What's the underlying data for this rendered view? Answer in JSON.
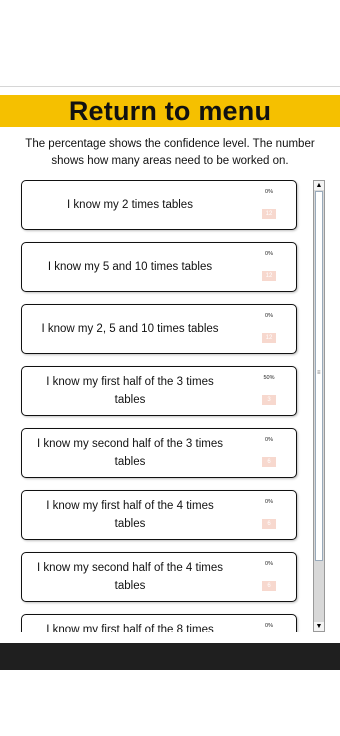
{
  "header": {
    "return_label": "Return to menu"
  },
  "instructions": {
    "line1": "The percentage shows the confidence level. The number",
    "line2": "shows how many areas need to be worked on."
  },
  "cards": [
    {
      "label": "I know my 2 times tables",
      "percent": "0%",
      "count": "12"
    },
    {
      "label": "I know my 5 and 10 times tables",
      "percent": "0%",
      "count": "12"
    },
    {
      "label": "I know my 2, 5 and 10 times tables",
      "percent": "0%",
      "count": "12"
    },
    {
      "label": "I know my first half of the 3 times tables",
      "percent": "50%",
      "count": "3"
    },
    {
      "label": "I know my second half of the 3 times tables",
      "percent": "0%",
      "count": "6"
    },
    {
      "label": "I know my first half of the 4 times tables",
      "percent": "0%",
      "count": "6"
    },
    {
      "label": "I know my second half of the 4 times tables",
      "percent": "0%",
      "count": "6"
    },
    {
      "label": "I know my first half of the 8 times",
      "percent": "0%",
      "count": ""
    }
  ],
  "scrollbar": {
    "up_arrow": "▲",
    "down_arrow": "▼",
    "grip": "≡"
  },
  "colors": {
    "banner": "#f5c000",
    "count_badge": "#f7d8ce",
    "bottom_bar": "#1f1f1f"
  }
}
